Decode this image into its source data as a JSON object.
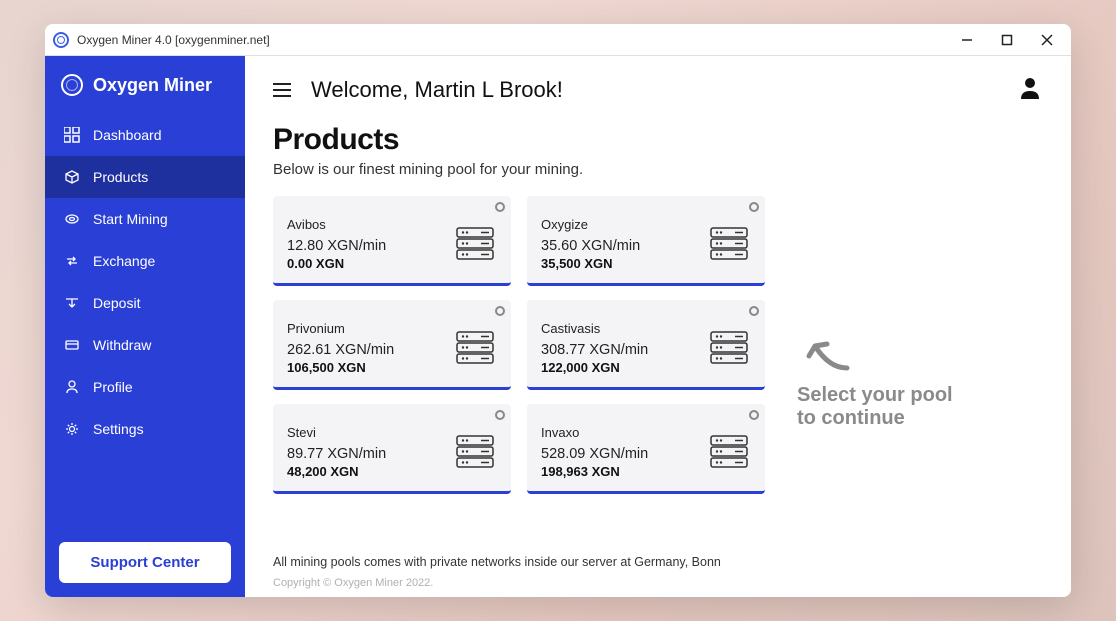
{
  "titlebar": {
    "title": "Oxygen Miner 4.0 [oxygenminer.net]"
  },
  "brand": {
    "name": "Oxygen Miner"
  },
  "sidebar": {
    "items": [
      {
        "label": "Dashboard"
      },
      {
        "label": "Products"
      },
      {
        "label": "Start Mining"
      },
      {
        "label": "Exchange"
      },
      {
        "label": "Deposit"
      },
      {
        "label": "Withdraw"
      },
      {
        "label": "Profile"
      },
      {
        "label": "Settings"
      }
    ],
    "support": "Support Center"
  },
  "topbar": {
    "welcome": "Welcome, Martin L Brook!"
  },
  "page": {
    "title": "Products",
    "subtitle": "Below is our finest mining pool for your mining.",
    "note": "All mining pools comes with private networks inside our server at Germany, Bonn",
    "copyright": "Copyright © Oxygen Miner 2022."
  },
  "hint": {
    "line1": "Select your pool",
    "line2": "to continue"
  },
  "products": [
    {
      "name": "Avibos",
      "rate": "12.80 XGN/min",
      "balance": "0.00 XGN"
    },
    {
      "name": "Oxygize",
      "rate": "35.60 XGN/min",
      "balance": "35,500 XGN"
    },
    {
      "name": "Privonium",
      "rate": "262.61 XGN/min",
      "balance": "106,500 XGN"
    },
    {
      "name": "Castivasis",
      "rate": "308.77 XGN/min",
      "balance": "122,000 XGN"
    },
    {
      "name": "Stevi",
      "rate": "89.77 XGN/min",
      "balance": "48,200 XGN"
    },
    {
      "name": "Invaxo",
      "rate": "528.09 XGN/min",
      "balance": "198,963 XGN"
    }
  ]
}
